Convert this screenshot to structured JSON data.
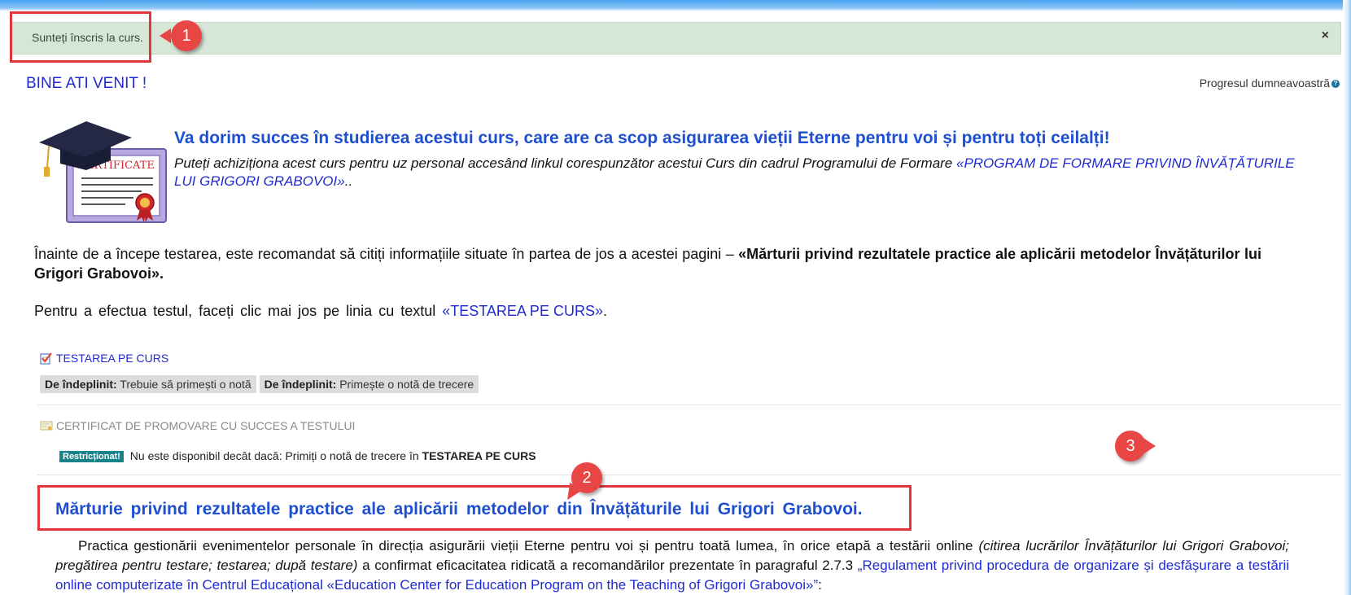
{
  "alert": {
    "message": "Sunteți înscris la curs.",
    "close": "×"
  },
  "callouts": [
    "1",
    "2",
    "3"
  ],
  "header": {
    "welcome": "BINE ATI VENIT !",
    "progress_label": "Progresul dumneavoastră",
    "progress_help": "?"
  },
  "certificate_image": {
    "label": "CERTIFICATE"
  },
  "intro": {
    "heading": "Va dorim succes în studierea acestui curs, care are ca scop asigurarea vieții Eterne pentru voi și pentru toți ceilalți!",
    "text": "Puteți achiziționa acest curs pentru uz personal accesând linkul corespunzător acestui Curs din cadrul Programului de Formare ",
    "link": "«PROGRAM DE FORMARE PRIVIND ÎNVĂȚĂTURILE LUI GRIGORI GRABOVOI»",
    "text_end": ".."
  },
  "paragraph1": {
    "text": "Înainte de a începe testarea, este recomandat să citiți informațiile situate în partea de jos a acestei pagini – ",
    "bold": "«Mărturii privind rezultatele practice ale aplicării metodelor Învățăturilor lui Grigori Grabovoi»."
  },
  "paragraph2": {
    "text": "Pentru a efectua testul, faceți clic mai jos pe linia cu textul ",
    "link": "«TESTAREA PE CURS»",
    "text_end": "."
  },
  "activity_test": {
    "label": "TESTAREA PE CURS",
    "badges": [
      {
        "bold": "De îndeplinit:",
        "text": " Trebuie să primești o notă"
      },
      {
        "bold": "De îndeplinit:",
        "text": " Primește o notă de trecere"
      }
    ]
  },
  "activity_certificate": {
    "label": "CERTIFICAT DE PROMOVARE CU SUCCES A TESTULUI",
    "restriction_badge": "Restricționat!",
    "restriction_text": " Nu este disponibil decât dacă: Primiți o notă de trecere în ",
    "restriction_bold": "TESTAREA PE CURS"
  },
  "testimony": {
    "heading": "Mărturie privind rezultatele practice ale aplicării metodelor din Învățăturile lui Grigori Grabovoi.",
    "body_start": "Practica gestionării evenimentelor personale în direcția asigurării vieții Eterne pentru voi și pentru toată lumea, în orice etapă a testării online ",
    "body_italic": "(citirea lucrărilor Învățăturilor lui Grigori Grabovoi; pregătirea pentru testare; testarea; după testare)",
    "body_mid": " a confirmat eficacitatea ridicată a recomandărilor prezentate în paragraful 2.7.3 ",
    "body_link": "„Regulament privind procedura de organizare și desfășurare a testării online computerizate în Centrul Educațional «Education Center for Education Program on the Teaching of Grigori Grabovoi»”",
    "body_end": ":"
  },
  "colors": {
    "alert_bg": "#d6e6d7",
    "link": "#1f2bd1",
    "heading": "#1f4fd1",
    "callout": "#e84545",
    "restricted": "#18838a"
  }
}
